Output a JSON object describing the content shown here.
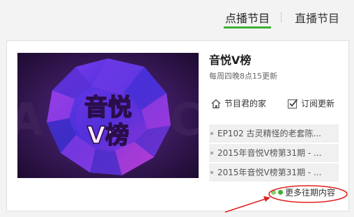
{
  "tabs": [
    {
      "label": "点播节目"
    },
    {
      "label": "直播节目"
    }
  ],
  "show": {
    "title": "音悦V榜",
    "schedule": "每周四晚8点15更新",
    "poster_text": "音悦V榜"
  },
  "actions": {
    "home_label": "节目君的家",
    "subscribe_label": "订阅更新"
  },
  "episodes": [
    {
      "title": "EP102 古灵精怪的老套陈..."
    },
    {
      "title": "2015年音悦V榜第31期 - ..."
    },
    {
      "title": "2015年音悦V榜第31期 - ..."
    }
  ],
  "more_label": "更多往期内容",
  "colors": {
    "accent_green": "#3cb034",
    "annotation_red": "#e02020"
  }
}
